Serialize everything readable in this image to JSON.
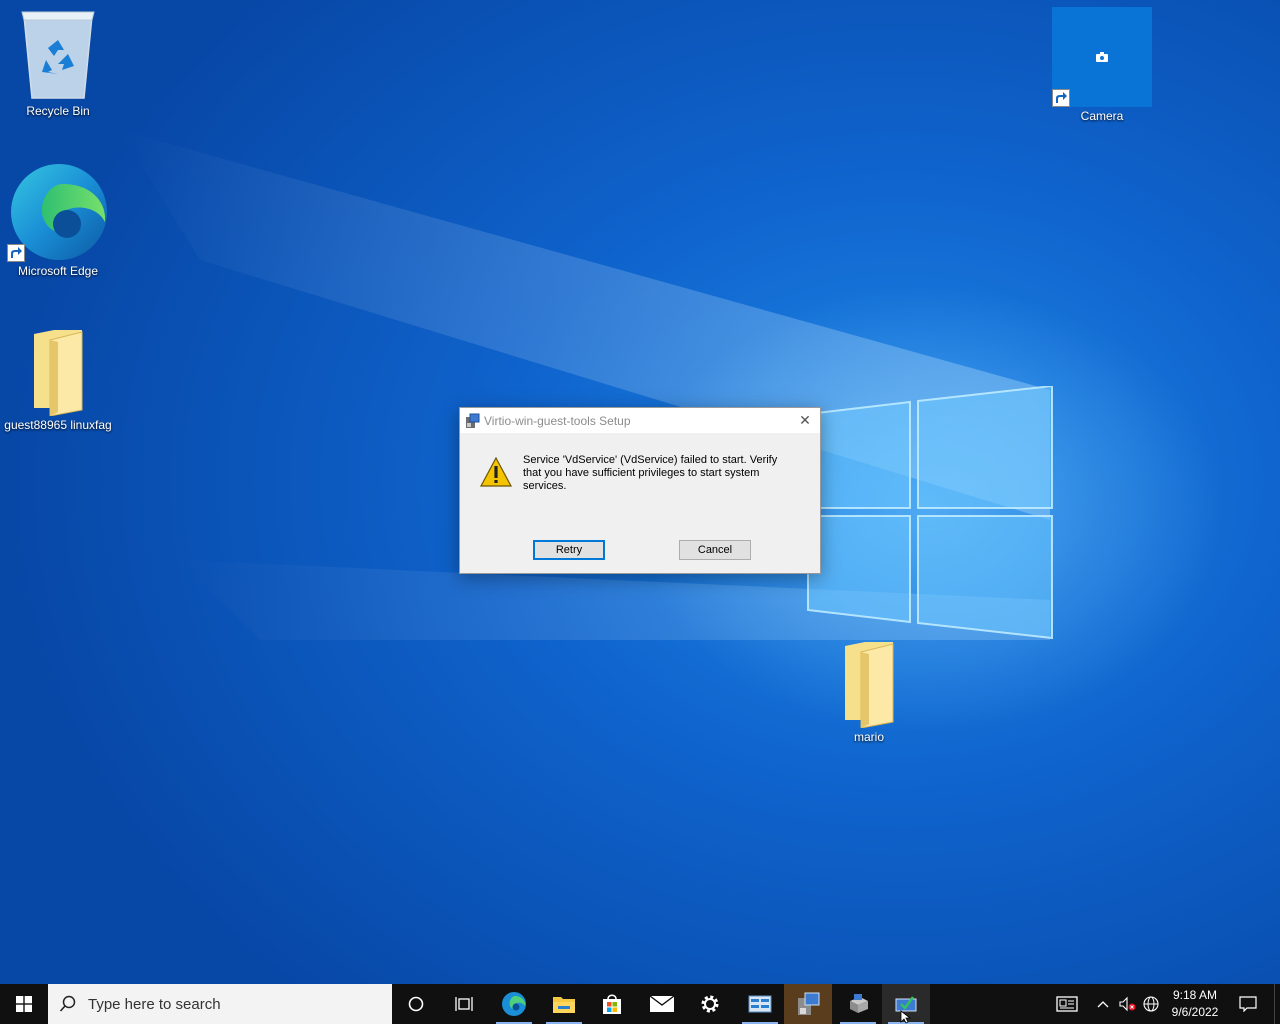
{
  "desktop": {
    "icons": [
      {
        "label": "Recycle Bin",
        "icon": "recycle-bin-icon"
      },
      {
        "label": "Microsoft Edge",
        "icon": "edge-icon"
      },
      {
        "label": "guest88965 linuxfag",
        "icon": "folder-icon"
      },
      {
        "label": "Camera",
        "icon": "camera-icon"
      },
      {
        "label": "mario",
        "icon": "folder-icon"
      }
    ]
  },
  "dialog": {
    "title": "Virtio-win-guest-tools Setup",
    "message": "Service 'VdService' (VdService) failed to start.  Verify that you have sufficient privileges to start system services.",
    "retry_label": "Retry",
    "cancel_label": "Cancel",
    "close_glyph": "✕"
  },
  "taskbar": {
    "search_placeholder": "Type here to search",
    "pinned": [
      "cortana-icon",
      "task-view-icon",
      "edge-icon",
      "file-explorer-icon",
      "store-icon",
      "mail-icon",
      "settings-icon",
      "control-panel-icon",
      "setup-installer-icon",
      "server-manager-icon",
      "remote-desktop-icon"
    ],
    "clock_time": "9:18 AM",
    "clock_date": "9/6/2022"
  },
  "colors": {
    "accent": "#0078d7",
    "taskbar": "#101010",
    "desktop": "#0f63cc"
  }
}
